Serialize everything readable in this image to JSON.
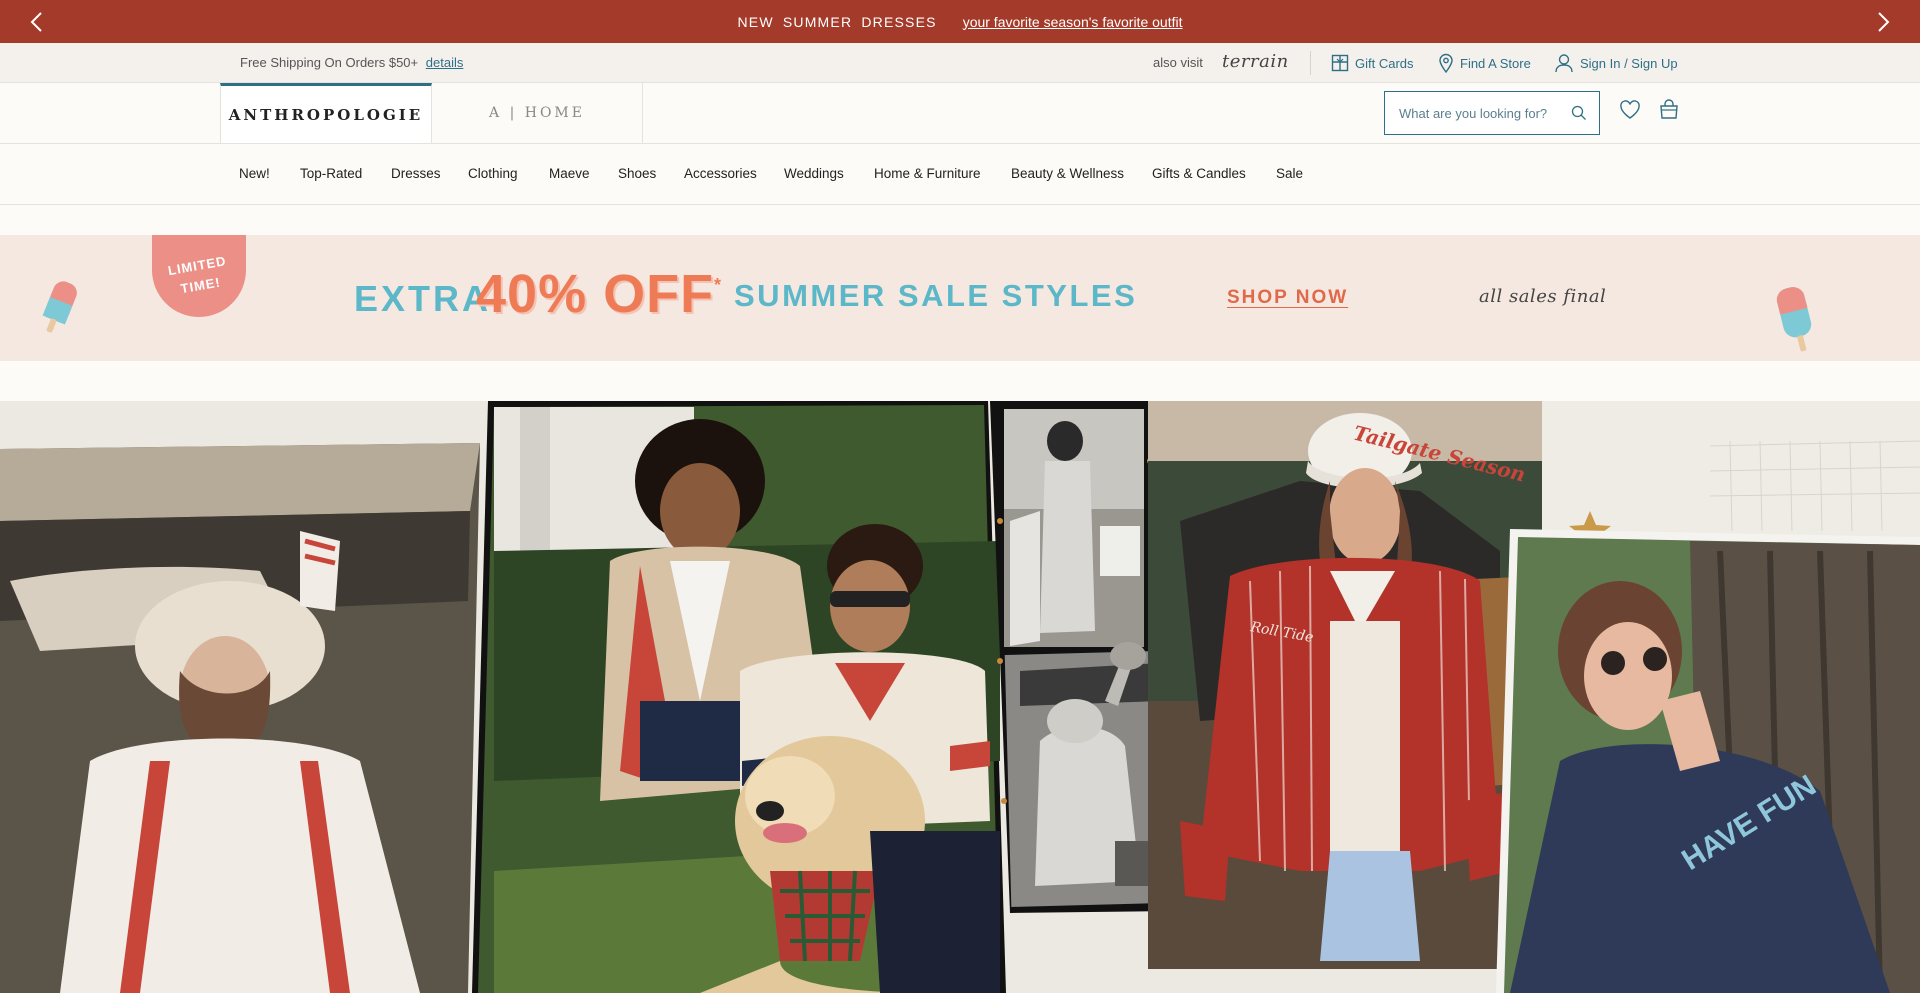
{
  "promo": {
    "main_text": "NEW SUMMER DRESSES",
    "link_text": "your favorite season's favorite outfit"
  },
  "utility": {
    "shipping_text": "Free Shipping On Orders $50+",
    "details_link": "details",
    "also_visit": "also visit",
    "terrain": "terrain",
    "gift_cards": "Gift Cards",
    "find_store": "Find A Store",
    "sign_in": "Sign In / Sign Up"
  },
  "header": {
    "brand_primary": "ANTHROPOLOGIE",
    "brand_home": "A | HOME",
    "search_placeholder": "What are you looking for?"
  },
  "nav": {
    "items": [
      "New!",
      "Top-Rated",
      "Dresses",
      "Clothing",
      "Maeve",
      "Shoes",
      "Accessories",
      "Weddings",
      "Home & Furniture",
      "Beauty & Wellness",
      "Gifts & Candles",
      "Sale"
    ]
  },
  "sale_banner": {
    "badge": "LIMITED TIME!",
    "extra": "EXTRA",
    "percent": "40% OFF",
    "asterisk": "*",
    "styles": "SUMMER SALE STYLES",
    "cta": "SHOP NOW",
    "note": "all sales final"
  },
  "hero": {
    "cap_text": "Tailgate Season",
    "jacket_text": "Roll Tide",
    "tee_text": "HAVE FUN"
  },
  "colors": {
    "promo_bg": "#a43a2a",
    "accent": "#2f6f86",
    "sale_blue": "#5cb7c9",
    "sale_orange": "#ef7b56"
  }
}
